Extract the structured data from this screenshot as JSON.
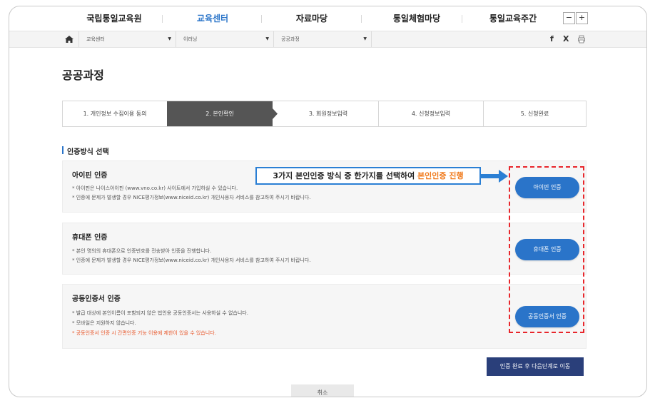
{
  "gnb": {
    "items": [
      {
        "label": "국립통일교육원",
        "active": false
      },
      {
        "label": "교육센터",
        "active": true
      },
      {
        "label": "자료마당",
        "active": false
      },
      {
        "label": "통일체험마당",
        "active": false
      },
      {
        "label": "통일교육주간",
        "active": false
      }
    ],
    "zoom_out": "−",
    "zoom_in": "+"
  },
  "location": {
    "home_icon": "home-icon",
    "crumbs": [
      {
        "label": "교육센터"
      },
      {
        "label": "이러닝"
      },
      {
        "label": "공공과정"
      }
    ],
    "sns": {
      "facebook": "f",
      "x": "X",
      "print_icon": "print-icon"
    }
  },
  "page_title": "공공과정",
  "steps": [
    {
      "label": "1. 개인정보 수집이용 동의",
      "active": false
    },
    {
      "label": "2. 본인확인",
      "active": true
    },
    {
      "label": "3. 회원정보입력",
      "active": false
    },
    {
      "label": "4. 신청정보입력",
      "active": false
    },
    {
      "label": "5. 신청완료",
      "active": false
    }
  ],
  "section_title": "인증방식 선택",
  "callout": {
    "text_prefix": "3가지 본인인증 방식 중 한가지를 선택하여 ",
    "text_highlight": "본인인증 진행",
    "highlight_color": "#f07a1c"
  },
  "methods": [
    {
      "title": "아이핀 인증",
      "lines": [
        "* 아이핀은 나이스아이핀 (www.vno.co.kr) 사이트에서 가입하실 수 있습니다.",
        "* 인증에 문제가 발생할 경우 NICE평가정보(www.niceid.co.kr) 개인사용자 서비스를 참고하여 주시기 바랍니다."
      ],
      "warning": "",
      "button": "아이핀 인증"
    },
    {
      "title": "휴대폰 인증",
      "lines": [
        "* 본인 명의의 휴대폰으로 인증번호를 전송받아 인증을 진행합니다.",
        "* 인증에 문제가 발생할 경우 NICE평가정보(www.niceid.co.kr) 개인사용자 서비스를 참고하여 주시기 바랍니다."
      ],
      "warning": "",
      "button": "휴대폰 인증"
    },
    {
      "title": "공동인증서 인증",
      "lines": [
        "* 발급 대상에 본인이름이 포함되지 않은 법인용 공동인증서는 사용하실 수 없습니다.",
        "* 모바일은 지원하지 않습니다."
      ],
      "warning": "* 공동인증서 인증 시 간편인증 기능 이용에 제한이 있을 수 있습니다.",
      "button": "공동인증서 인증"
    }
  ],
  "next_button": "인증 완료 후 다음단계로 이동",
  "cancel_button": "취소",
  "colors": {
    "accent": "#2a74c9",
    "active_step": "#555555",
    "next_button": "#2a3f7a",
    "dashed_highlight": "#e8262b"
  }
}
